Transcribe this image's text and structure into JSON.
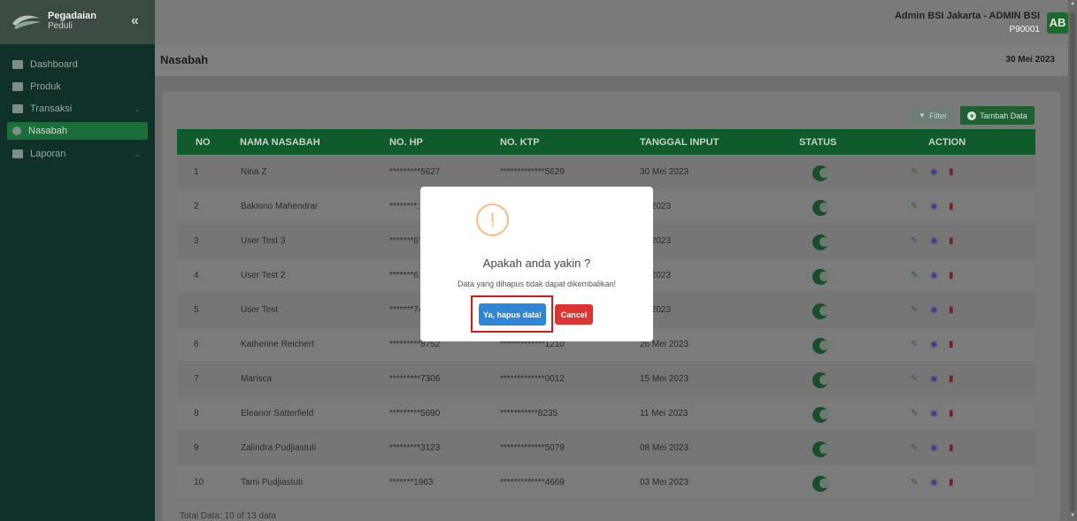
{
  "header": {
    "logo_line1": "Pegadaian",
    "logo_line2": "Peduli",
    "collapse": "«",
    "user_name": "Admin BSI Jakarta - ADMIN BSI",
    "user_id": "P90001",
    "avatar": "AB"
  },
  "sidebar": {
    "items": [
      {
        "label": "Dashboard",
        "icon": "dashboard-icon",
        "chevron": false
      },
      {
        "label": "Produk",
        "icon": "grid-icon",
        "chevron": false
      },
      {
        "label": "Transaksi",
        "icon": "card-icon",
        "chevron": true
      },
      {
        "label": "Nasabah",
        "icon": "user-icon",
        "chevron": false,
        "active": true
      },
      {
        "label": "Laporan",
        "icon": "calendar-icon",
        "chevron": true
      }
    ]
  },
  "page": {
    "title": "Nasabah",
    "date": "30 Mei 2023",
    "filter_label": "Filter",
    "add_label": "Tambah Data",
    "footer": "Total Data: 10 of 13 data"
  },
  "table": {
    "headers": [
      "NO",
      "NAMA NASABAH",
      "NO. HP",
      "NO. KTP",
      "TANGGAL INPUT",
      "STATUS",
      "ACTION"
    ],
    "rows": [
      {
        "no": "1",
        "name": "Nina Z",
        "hp": "*********5627",
        "ktp": "*************5629",
        "date": "30 Mei 2023"
      },
      {
        "no": "2",
        "name": "Bakiono Mahendrar",
        "hp": "********:",
        "ktp": "",
        "date": "lei 2023"
      },
      {
        "no": "3",
        "name": "User Test 3",
        "hp": "*******6'",
        "ktp": "",
        "date": "lei 2023"
      },
      {
        "no": "4",
        "name": "User Test 2",
        "hp": "*******6:",
        "ktp": "",
        "date": "lei 2023"
      },
      {
        "no": "5",
        "name": "User Test",
        "hp": "*******74",
        "ktp": "",
        "date": "lei 2023"
      },
      {
        "no": "6",
        "name": "Katherine Reichert",
        "hp": "*********8752",
        "ktp": "*************1210",
        "date": "26 Mei 2023"
      },
      {
        "no": "7",
        "name": "Marisca",
        "hp": "*********7306",
        "ktp": "*************0012",
        "date": "15 Mei 2023"
      },
      {
        "no": "8",
        "name": "Eleanor Satterfield",
        "hp": "*********5690",
        "ktp": "***********8235",
        "date": "11 Mei 2023"
      },
      {
        "no": "9",
        "name": "Zalindra Pudjiastuti",
        "hp": "*********3123",
        "ktp": "*************5079",
        "date": "08 Mei 2023"
      },
      {
        "no": "10",
        "name": "Tami Pudjiastuti",
        "hp": "*******1963",
        "ktp": "*************4669",
        "date": "03 Mei 2023"
      }
    ]
  },
  "modal": {
    "icon": "!",
    "title": "Apakah anda yakin ?",
    "text": "Data yang dihapus tidak dapat dikembalikan!",
    "confirm": "Ya, hapus data!",
    "cancel": "Cancel"
  },
  "colors": {
    "accent_green": "#0f5b2c",
    "confirm_blue": "#3085d6",
    "cancel_red": "#dd3333",
    "warning_orange": "#f8bb86",
    "highlight_red": "#d31b1b"
  }
}
